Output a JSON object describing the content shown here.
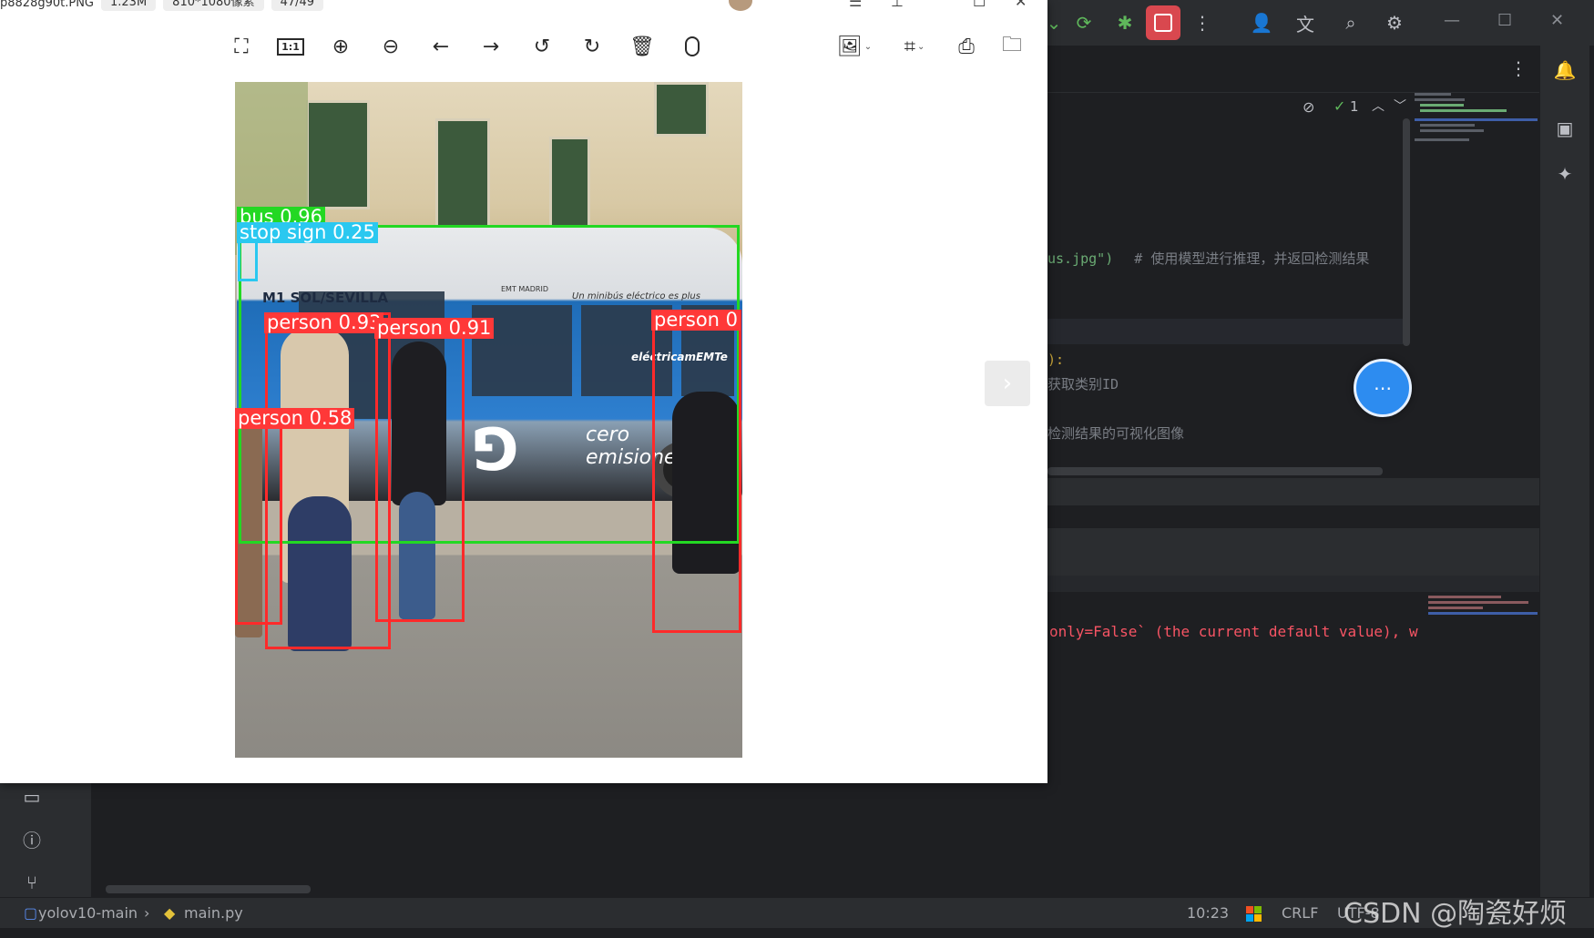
{
  "viewer": {
    "file_name": "p8828g90t.PNG",
    "file_size": "1.23M",
    "dimensions": "810*1080像素",
    "counter": "47/49",
    "next_symbol": "›"
  },
  "detections": [
    {
      "label": "bus 0.96",
      "color": "#23d823",
      "label_bg": "#23d823"
    },
    {
      "label": "stop sign 0.25",
      "color": "#2ac8f0",
      "label_bg": "#2ac8f0"
    },
    {
      "label": "person 0.93",
      "color": "#ff2a2a",
      "label_bg": "#ff3838"
    },
    {
      "label": "person 0.91",
      "color": "#ff2a2a",
      "label_bg": "#ff3838"
    },
    {
      "label": "person 0.58",
      "color": "#ff2a2a",
      "label_bg": "#ff3838"
    },
    {
      "label": "person 0",
      "color": "#ff2a2a",
      "label_bg": "#ff3838"
    }
  ],
  "photo": {
    "bus_route": "M1 SOL/SEVILLA",
    "bus_slogan": "Un minibús eléctrico es plus",
    "bus_brand": "eléctricamEMTe",
    "bus_text_cero": "cero",
    "bus_text_emisiones": "emisiones",
    "bus_logo": "EMT MADRID"
  },
  "editor": {
    "inspection_count": "1",
    "code_line_1_str": "us.jpg\")",
    "code_line_1_comment": "# 使用模型进行推理，并返回检测结果",
    "code_line_2": "):",
    "code_line_3_comment": "获取类别ID",
    "code_line_4_comment": "检测结果的可视化图像",
    "console_line": "only=False` (the current default value), w"
  },
  "statusbar": {
    "project": "yolov10-main",
    "separator": "›",
    "file": "main.py",
    "position": "10:23",
    "line_ending": "CRLF",
    "encoding": "UTF-8"
  },
  "watermark": "CSDN @陶瓷好烦"
}
